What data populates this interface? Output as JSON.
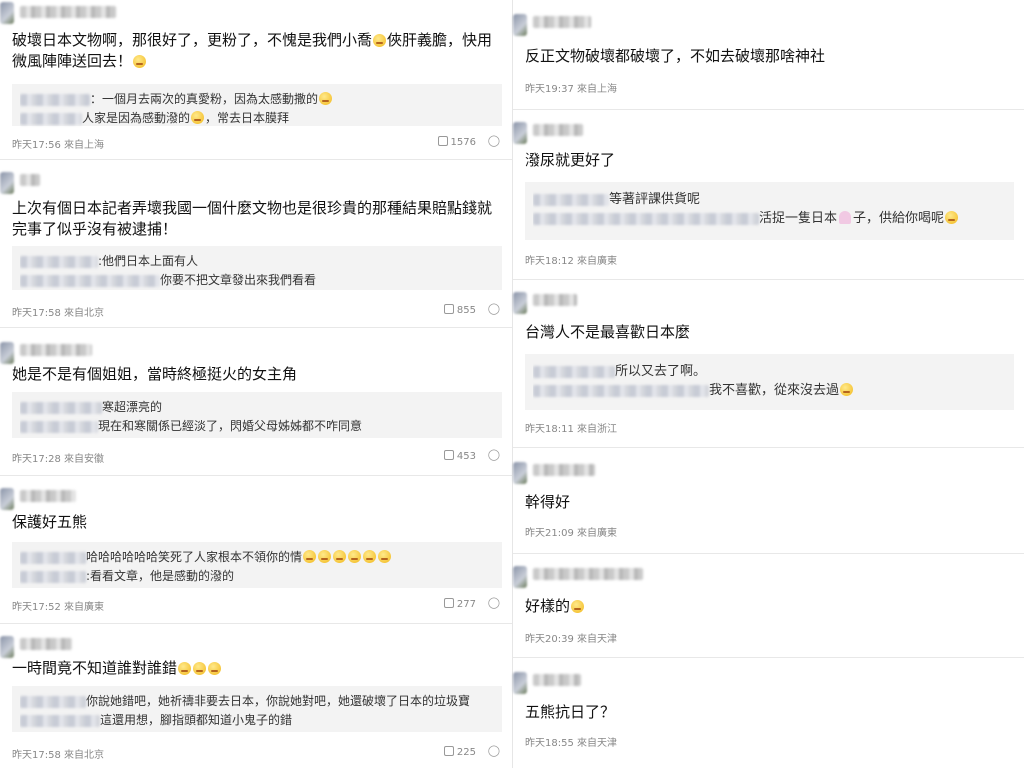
{
  "left": [
    {
      "comment": "破壞日本文物啊，那很好了，更粉了，不愧是我們小喬",
      "comment_tail": "俠肝義膽，快用微風陣陣送回去！",
      "quote": [
        "：一個月去兩次的真愛粉，因為太感動撒的",
        "人家是因為感動潑的",
        "，常去日本膜拜"
      ],
      "meta": "昨天17:56 來自上海",
      "likes": "1576"
    },
    {
      "comment": "上次有個日本記者弄壞我國一個什麼文物也是很珍貴的那種結果賠點錢就完事了似乎沒有被逮捕！",
      "quote": [
        ":他們日本上面有人",
        "你要不把文章發出來我們看看"
      ],
      "meta": "昨天17:58 來自北京",
      "likes": "855"
    },
    {
      "comment": "她是不是有個姐姐，當時終極挺火的女主角",
      "quote": [
        "寒超漂亮的",
        "現在和寒關係已經淡了，閃婚父母姊姊都不咋同意"
      ],
      "meta": "昨天17:28 來自安徽",
      "likes": "453"
    },
    {
      "comment": "保護好五熊",
      "quote": [
        "哈哈哈哈哈哈笑死了人家根本不領你的情",
        ":看看文章，他是感動的潑的"
      ],
      "meta": "昨天17:52 來自廣東",
      "likes": "277"
    },
    {
      "comment": "一時間竟不知道誰對誰錯",
      "quote": [
        "你說她錯吧，她祈禱非要去日本，你說她對吧，她還破壞了日本的垃圾寶",
        "這還用想，腳指頭都知道小鬼子的錯"
      ],
      "meta": "昨天17:58 來自北京",
      "likes": "225"
    }
  ],
  "right": [
    {
      "comment": "反正文物破壞都破壞了，不如去破壞那啥神社",
      "meta": "昨天19:37 來自上海"
    },
    {
      "comment": "潑尿就更好了",
      "quote": [
        "等著評課供貨呢",
        "活捉一隻日本",
        "子，供給你喝呢"
      ],
      "meta": "昨天18:12 來自廣東"
    },
    {
      "comment": "台灣人不是最喜歡日本麼",
      "quote": [
        "所以又去了啊。",
        "我不喜歡，從來沒去過"
      ],
      "meta": "昨天18:11 來自浙江"
    },
    {
      "comment": "幹得好",
      "meta": "昨天21:09 來自廣東"
    },
    {
      "comment": "好樣的",
      "meta": "昨天20:39 來自天津"
    },
    {
      "comment": "五熊抗日了？",
      "meta": "昨天18:55 來自天津"
    }
  ],
  "icons": {
    "like": "thumb-up-icon",
    "reply": "reply-bubble-icon",
    "emoji": "emoji-face-icon"
  }
}
